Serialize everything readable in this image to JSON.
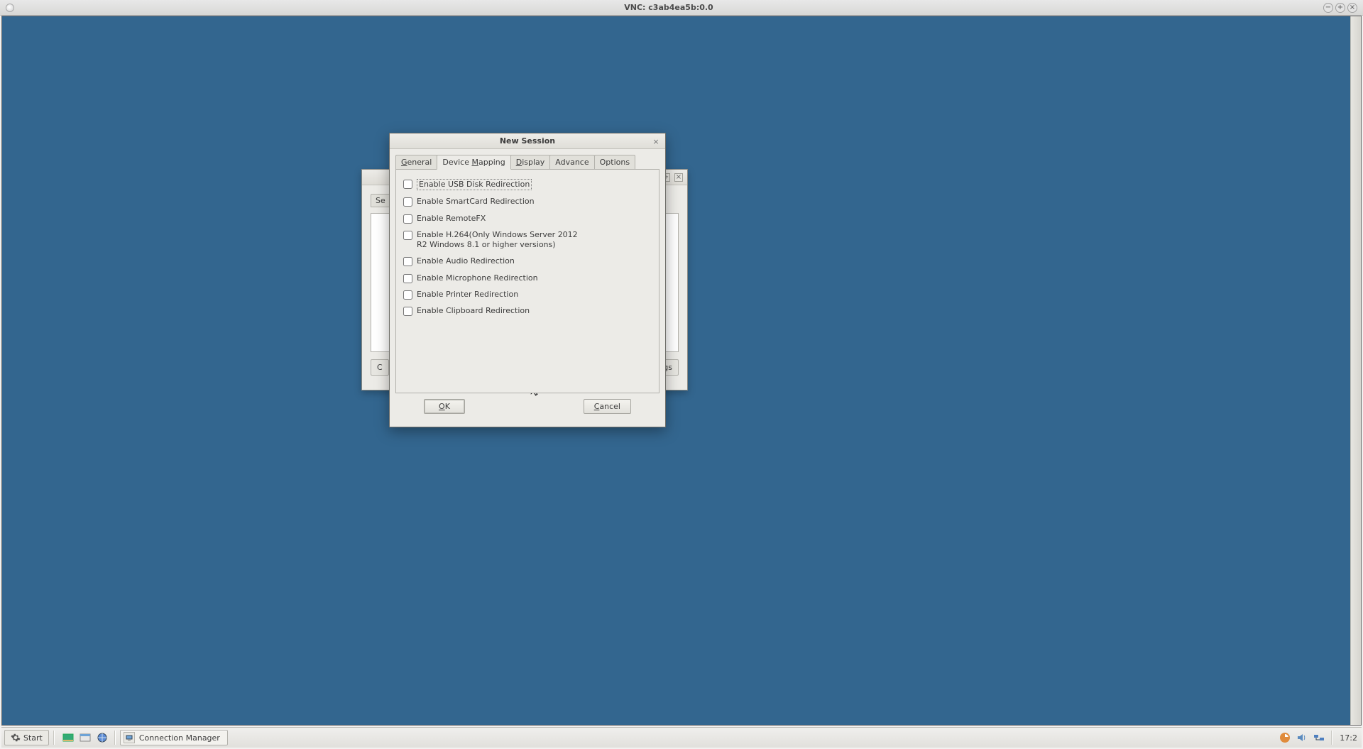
{
  "outer": {
    "title": "VNC: c3ab4ea5b:0.0"
  },
  "dialog": {
    "title": "New Session",
    "tabs": {
      "general": "General",
      "device_mapping": "Device Mapping",
      "display": "Display",
      "advance": "Advance",
      "options": "Options"
    },
    "checkboxes": {
      "usb": "Enable USB Disk Redirection",
      "smartcard": "Enable SmartCard Redirection",
      "remotefx": "Enable RemoteFX",
      "h264": "Enable H.264(Only Windows Server 2012 R2 Windows 8.1 or higher versions)",
      "audio": "Enable Audio Redirection",
      "mic": "Enable Microphone Redirection",
      "printer": "Enable Printer Redirection",
      "clipboard": "Enable Clipboard Redirection"
    },
    "buttons": {
      "ok": "OK",
      "cancel": "Cancel"
    }
  },
  "back_window": {
    "tab_stub": "Se",
    "btn_left": "C",
    "btn_right": "gs"
  },
  "taskbar": {
    "start": "Start",
    "task1": "Connection Manager",
    "clock": "17:2"
  }
}
